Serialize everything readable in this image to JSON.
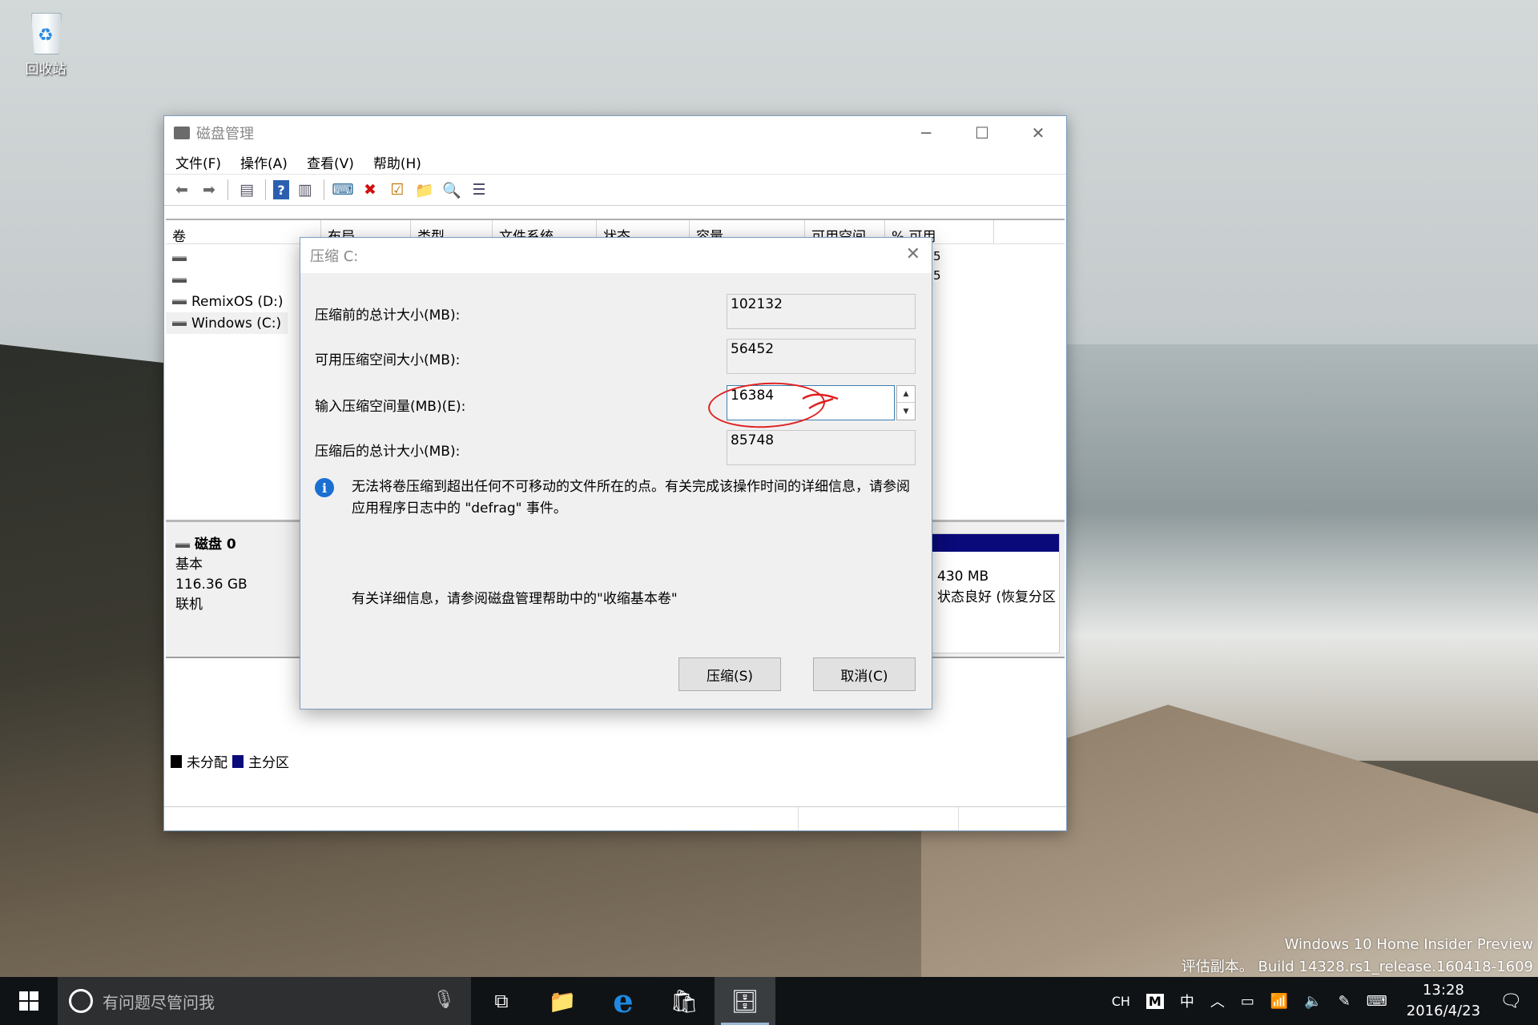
{
  "desktop": {
    "recycle_bin_label": "回收站",
    "watermark_line1": "Windows 10 Home Insider Preview",
    "watermark_line2": "评估副本。 Build 14328.rs1_release.160418-1609"
  },
  "window": {
    "title": "磁盘管理",
    "menu": [
      "文件(F)",
      "操作(A)",
      "查看(V)",
      "帮助(H)"
    ],
    "columns": [
      "卷",
      "布局",
      "类型",
      "文件系统",
      "状态",
      "容量",
      "可用空间",
      "% 可用"
    ],
    "volumes": [
      "",
      "",
      "RemixOS (D:)",
      "Windows (C:)"
    ],
    "partial_values": [
      "5",
      "5"
    ],
    "disk": {
      "name": "磁盘 0",
      "type": "基本",
      "size": "116.36 GB",
      "status": "联机"
    },
    "partition_right": {
      "size": "430 MB",
      "status": "状态良好 (恢复分区"
    },
    "legend": [
      {
        "label": "未分配",
        "color": "#000000"
      },
      {
        "label": "主分区",
        "color": "#0a0a7a"
      }
    ]
  },
  "dialog": {
    "title": "压缩 C:",
    "fields": [
      {
        "label": "压缩前的总计大小(MB):",
        "value": "102132"
      },
      {
        "label": "可用压缩空间大小(MB):",
        "value": "56452"
      },
      {
        "label": "输入压缩空间量(MB)(E):",
        "value": "16384"
      },
      {
        "label": "压缩后的总计大小(MB):",
        "value": "85748"
      }
    ],
    "info_text": "无法将卷压缩到超出任何不可移动的文件所在的点。有关完成该操作时间的详细信息，请参阅应用程序日志中的 \"defrag\" 事件。",
    "help_text": "有关详细信息，请参阅磁盘管理帮助中的\"收缩基本卷\"",
    "shrink_button": "压缩(S)",
    "cancel_button": "取消(C)"
  },
  "taskbar": {
    "search_placeholder": "有问题尽管问我",
    "ime_lang": "CH",
    "ime_mode": "中",
    "time": "13:28",
    "date": "2016/4/23"
  }
}
